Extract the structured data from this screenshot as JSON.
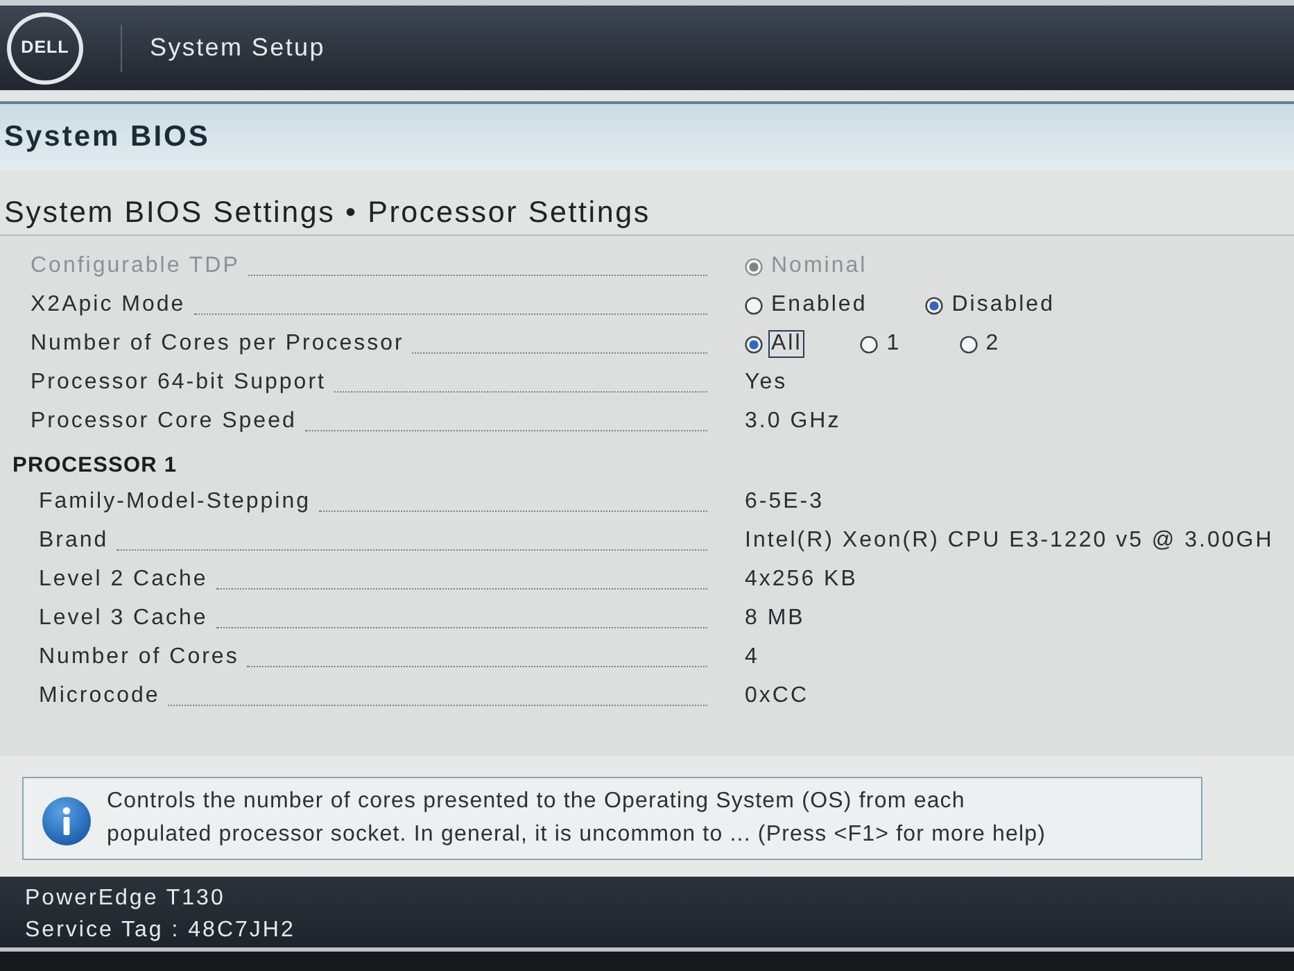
{
  "header": {
    "logo": "DELL",
    "title": "System Setup"
  },
  "section": {
    "title": "System BIOS"
  },
  "breadcrumb": "System BIOS Settings • Processor Settings",
  "settings": [
    {
      "label": "Configurable TDP",
      "kind": "radio",
      "disabled": true,
      "options": [
        {
          "label": "Nominal",
          "selected": true,
          "focused": false
        }
      ]
    },
    {
      "label": "X2Apic Mode",
      "kind": "radio",
      "disabled": false,
      "options": [
        {
          "label": "Enabled",
          "selected": false,
          "focused": false
        },
        {
          "label": "Disabled",
          "selected": true,
          "focused": false
        }
      ]
    },
    {
      "label": "Number of Cores per Processor",
      "kind": "radio",
      "disabled": false,
      "options": [
        {
          "label": "All",
          "selected": true,
          "focused": true
        },
        {
          "label": "1",
          "selected": false,
          "focused": false
        },
        {
          "label": "2",
          "selected": false,
          "focused": false
        }
      ]
    },
    {
      "label": "Processor 64-bit Support",
      "kind": "value",
      "disabled": false,
      "value": "Yes"
    },
    {
      "label": "Processor Core Speed",
      "kind": "value",
      "disabled": false,
      "value": "3.0 GHz"
    }
  ],
  "processor": {
    "heading": "PROCESSOR 1",
    "rows": [
      {
        "label": "Family-Model-Stepping",
        "value": "6-5E-3"
      },
      {
        "label": "Brand",
        "value": "Intel(R) Xeon(R) CPU E3-1220 v5 @ 3.00GH"
      },
      {
        "label": "Level 2 Cache",
        "value": "4x256 KB"
      },
      {
        "label": "Level 3 Cache",
        "value": "8 MB"
      },
      {
        "label": "Number of Cores",
        "value": "4"
      },
      {
        "label": "Microcode",
        "value": "0xCC"
      }
    ]
  },
  "help": {
    "text": "Controls the number of cores presented to the Operating System (OS) from each populated processor socket. In general, it is uncommon to ... (Press <F1> for more help)"
  },
  "footer": {
    "model": "PowerEdge T130",
    "service_tag": "Service Tag : 48C7JH2"
  }
}
